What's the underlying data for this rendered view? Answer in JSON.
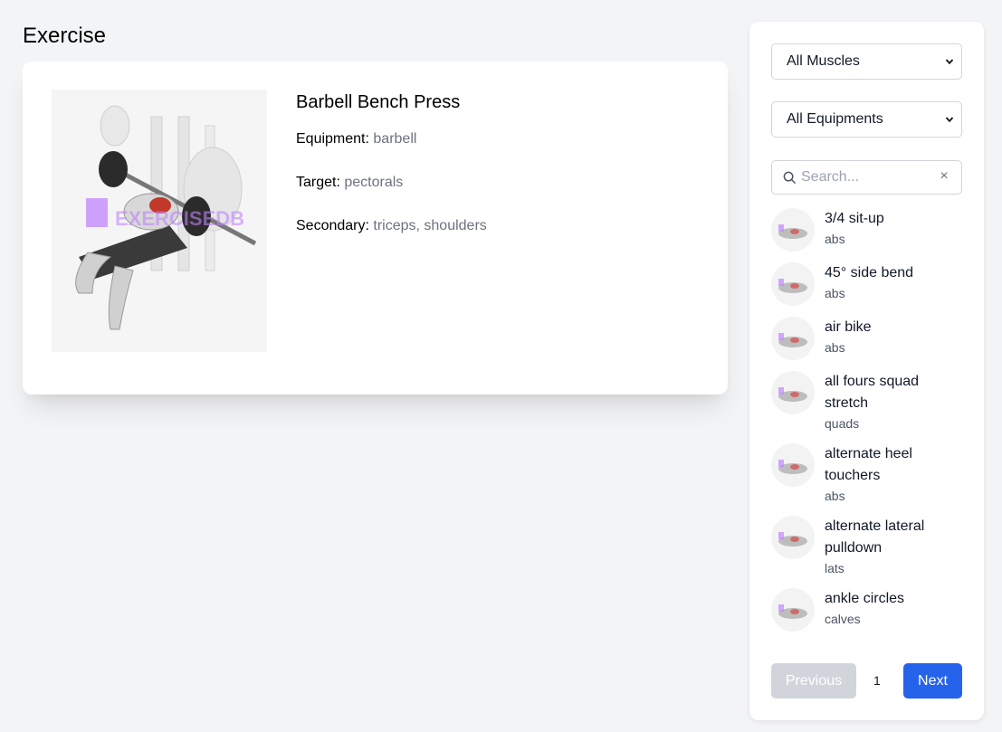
{
  "page": {
    "title": "Exercise"
  },
  "detail": {
    "name": "Barbell Bench Press",
    "equipment_label": "Equipment:",
    "equipment": "barbell",
    "target_label": "Target:",
    "target": "pectorals",
    "secondary_label": "Secondary:",
    "secondary": "triceps, shoulders"
  },
  "filters": {
    "muscle": "All Muscles",
    "equipment": "All Equipments",
    "search_placeholder": "Search...",
    "search_value": ""
  },
  "exercises": [
    {
      "name": "3/4 sit-up",
      "muscle": "abs"
    },
    {
      "name": "45° side bend",
      "muscle": "abs"
    },
    {
      "name": "air bike",
      "muscle": "abs"
    },
    {
      "name": "all fours squad stretch",
      "muscle": "quads"
    },
    {
      "name": "alternate heel touchers",
      "muscle": "abs"
    },
    {
      "name": "alternate lateral pulldown",
      "muscle": "lats"
    },
    {
      "name": "ankle circles",
      "muscle": "calves"
    }
  ],
  "pagination": {
    "prev": "Previous",
    "page": "1",
    "next": "Next"
  },
  "colors": {
    "primary": "#2563eb",
    "disabled": "#d1d5db",
    "muted": "#6b7280"
  }
}
